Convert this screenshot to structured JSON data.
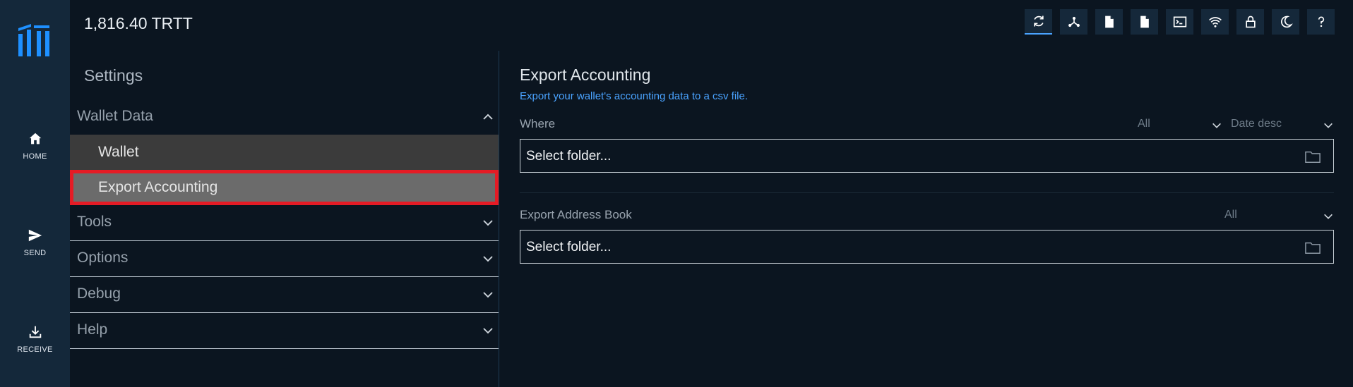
{
  "header": {
    "balance": "1,816.40 TRTT",
    "toolbar_icons": [
      "refresh-icon",
      "network-icon",
      "file-icon",
      "file-icon",
      "terminal-icon",
      "wifi-icon",
      "lock-icon",
      "moon-icon",
      "help-icon"
    ]
  },
  "rail": {
    "items": [
      {
        "label": "HOME",
        "icon": "home-icon"
      },
      {
        "label": "SEND",
        "icon": "send-icon"
      },
      {
        "label": "RECEIVE",
        "icon": "receive-icon"
      }
    ]
  },
  "settings": {
    "title": "Settings",
    "sections": [
      {
        "label": "Wallet Data",
        "expanded": true,
        "items": [
          "Wallet",
          "Export Accounting"
        ]
      },
      {
        "label": "Tools"
      },
      {
        "label": "Options"
      },
      {
        "label": "Debug"
      },
      {
        "label": "Help"
      }
    ],
    "selected_item": "Export Accounting"
  },
  "content": {
    "title": "Export Accounting",
    "description": "Export your wallet's accounting data to a csv file.",
    "where": {
      "label": "Where",
      "filter_value": "All",
      "sort_value": "Date desc",
      "folder_value": "Select folder..."
    },
    "address_book": {
      "label": "Export Address Book",
      "filter_value": "All",
      "folder_value": "Select folder..."
    }
  },
  "colors": {
    "background": "#0b1520",
    "rail": "#14283a",
    "accent": "#4aa3ff",
    "selection_outline": "#e51b25",
    "selected_bg": "#6b6b6b",
    "submenu_bg": "#3b3b3b"
  }
}
